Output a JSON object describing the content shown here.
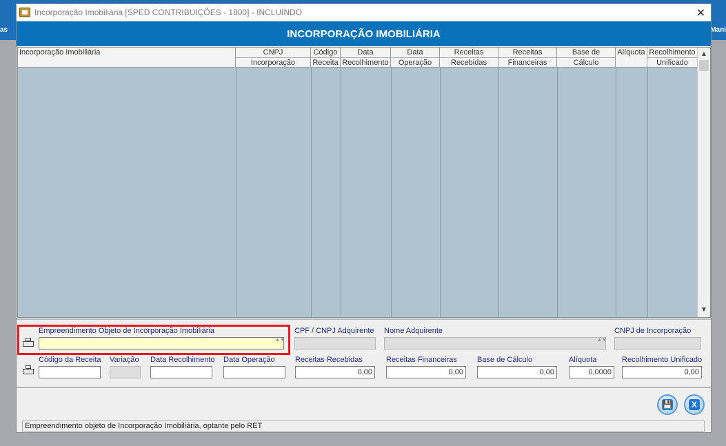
{
  "window": {
    "title": "Incorporação Imobiliária  [SPED CONTRIBUIÇÕES - 1800]   -   INCLUINDO",
    "close_glyph": "✕",
    "banner": "INCORPORAÇÃO IMOBILIÁRIA"
  },
  "background": {
    "left_label": "as",
    "right_label": "Mani"
  },
  "grid": {
    "columns": [
      {
        "line1": "Incorporação Imobiliária",
        "line2": ""
      },
      {
        "line1": "CNPJ",
        "line2": "Incorporação"
      },
      {
        "line1": "Código",
        "line2": "Receita"
      },
      {
        "line1": "Data",
        "line2": "Recolhimento"
      },
      {
        "line1": "Data",
        "line2": "Operação"
      },
      {
        "line1": "Receitas",
        "line2": "Recebidas"
      },
      {
        "line1": "Receitas",
        "line2": "Financeiras"
      },
      {
        "line1": "Base de",
        "line2": "Cálculo"
      },
      {
        "line1": "Alíquota",
        "line2": ""
      },
      {
        "line1": "Recolhimento",
        "line2": "Unificado"
      }
    ],
    "rows": [],
    "scroll_up_glyph": "▲",
    "scroll_down_glyph": "▼"
  },
  "form": {
    "empreendimento": {
      "label": "Empreendimento Objeto de Incorporação Imobiliária",
      "value": ""
    },
    "cpf_cnpj_adquirente": {
      "label": "CPF / CNPJ Adquirente",
      "value": ""
    },
    "nome_adquirente": {
      "label": "Nome Adquirente",
      "value": ""
    },
    "cnpj_incorporacao": {
      "label": "CNPJ de Incorporação",
      "value": ""
    },
    "codigo_receita": {
      "label": "Código da Receita",
      "value": ""
    },
    "variacao": {
      "label": "Variação",
      "value": ""
    },
    "data_recolhimento": {
      "label": "Data Recolhimento",
      "value": ""
    },
    "data_operacao": {
      "label": "Data Operação",
      "value": ""
    },
    "receitas_recebidas": {
      "label": "Receitas Recebidas",
      "value": "0,00"
    },
    "receitas_financeiras": {
      "label": "Receitas Financeiras",
      "value": "0,00"
    },
    "base_calculo": {
      "label": "Base de Cálculo",
      "value": "0,00"
    },
    "aliquota": {
      "label": "Alíquota",
      "value": "0,0000"
    },
    "recolhimento_unificado": {
      "label": "Recolhimento Unificado",
      "value": "0,00"
    },
    "spin_glyph": "▲▼"
  },
  "buttons": {
    "save_glyph": "💾",
    "close_glyph": "X"
  },
  "status": {
    "text": "Empreendimento objeto de Incorporação Imobiliária, optante pelo RET"
  },
  "colors": {
    "banner": "#0a72b8",
    "grid_body": "#b0c4cf",
    "highlight": "#e31b23",
    "label": "#1f2a7a"
  }
}
